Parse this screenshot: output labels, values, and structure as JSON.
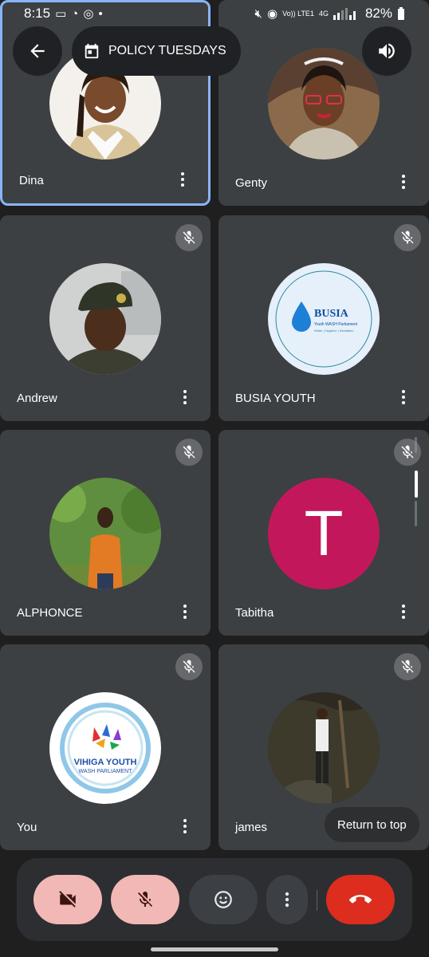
{
  "status_bar": {
    "time": "8:15",
    "battery": "82%",
    "network": "4G",
    "volte": "Vo)) LTE1"
  },
  "header": {
    "meeting_title": "POLICY TUESDAYS"
  },
  "participants": [
    {
      "name": "Dina",
      "muted": false,
      "active": true
    },
    {
      "name": "Genty",
      "muted": false,
      "active": false
    },
    {
      "name": "Andrew",
      "muted": true,
      "active": false
    },
    {
      "name": "BUSIA YOUTH",
      "muted": true,
      "active": false,
      "logo_text": "BUSIA",
      "logo_sub": "Youth WASH Parliament",
      "logo_tag": "Water | Hygiene | Sanitation"
    },
    {
      "name": "ALPHONCE",
      "muted": true,
      "active": false
    },
    {
      "name": "Tabitha",
      "muted": true,
      "active": false,
      "initial": "T",
      "avatar_color": "#c2185b"
    },
    {
      "name": "You",
      "muted": true,
      "active": false,
      "logo_text": "VIHIGA YOUTH",
      "logo_sub": "WASH PARLIAMENT"
    },
    {
      "name": "james",
      "muted": true,
      "active": false
    }
  ],
  "return_to_top": "Return to top",
  "colors": {
    "tile_bg": "#3c4043",
    "active_border": "#8ab4f8",
    "hangup": "#dc2d1e",
    "muted_control": "#f2b8b5"
  }
}
